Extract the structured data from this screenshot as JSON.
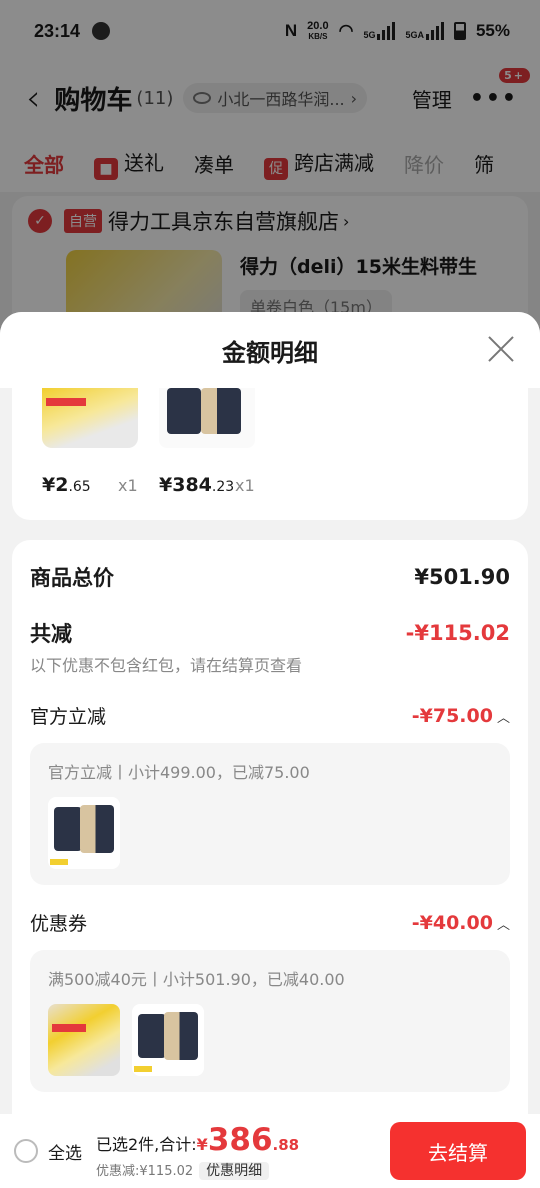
{
  "status": {
    "time": "23:14",
    "speed_value": "20.0",
    "speed_unit": "KB/S",
    "net1": "5G",
    "net2": "5GA",
    "battery": "55%"
  },
  "header": {
    "title": "购物车",
    "count": "(11)",
    "address": "小北一西路华润...",
    "manage": "管理",
    "badge": "5+"
  },
  "tabs": [
    {
      "label": "全部",
      "active": true
    },
    {
      "label": "送礼",
      "icon": "gift-icon"
    },
    {
      "label": "凑单"
    },
    {
      "label": "跨店满减",
      "icon_text": "促"
    },
    {
      "label": "降价"
    },
    {
      "label": "筛"
    }
  ],
  "store": {
    "tag": "自营",
    "name": "得力工具京东自营旗舰店",
    "product_title": "得力（deli）15米生料带生",
    "spec": "单卷白色（15m）"
  },
  "sheet": {
    "title": "金额明细",
    "items": [
      {
        "price_int": "¥2",
        "price_dec": ".65",
        "qty": "x1"
      },
      {
        "price_int": "¥384",
        "price_dec": ".23",
        "qty": "x1"
      }
    ],
    "total_label": "商品总价",
    "total_amount": "¥501.90",
    "discount_label": "共减",
    "discount_amount": "-¥115.02",
    "discount_note": "以下优惠不包含红包，请在结算页查看",
    "official": {
      "label": "官方立减",
      "amount": "-¥75.00",
      "desc": "官方立减丨小计499.00，已减75.00"
    },
    "coupon": {
      "label": "优惠券",
      "amount": "-¥40.00",
      "desc": "满500减40元丨小计501.90，已减40.00"
    }
  },
  "bottom": {
    "select_all": "全选",
    "selected_text": "已选2件,合计:",
    "currency": "¥",
    "total_int": "386",
    "total_dec": ".88",
    "discount_text": "优惠减:¥115.02",
    "detail_btn": "优惠明细",
    "checkout": "去结算"
  }
}
